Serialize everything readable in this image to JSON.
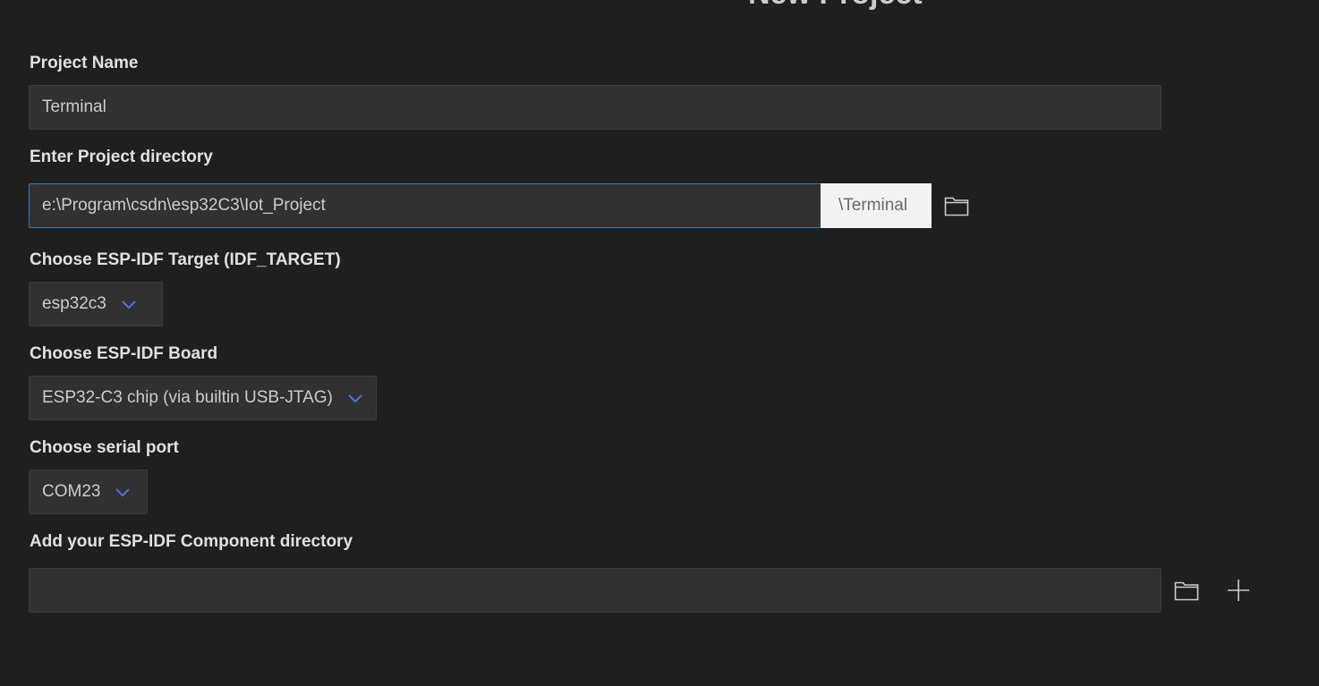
{
  "page_title": "New Project",
  "project_name": {
    "label": "Project Name",
    "value": "Terminal"
  },
  "project_directory": {
    "label": "Enter Project directory",
    "value": "e:\\Program\\csdn\\esp32C3\\Iot_Project",
    "suffix": "\\Terminal",
    "browse_icon": "folder-icon"
  },
  "idf_target": {
    "label": "Choose ESP-IDF Target (IDF_TARGET)",
    "selected": "esp32c3",
    "icon": "chevron-down-icon"
  },
  "idf_board": {
    "label": "Choose ESP-IDF Board",
    "selected": "ESP32-C3 chip (via builtin USB-JTAG)",
    "icon": "chevron-down-icon"
  },
  "serial_port": {
    "label": "Choose serial port",
    "selected": "COM23",
    "icon": "chevron-down-icon"
  },
  "component_directory": {
    "label": "Add your ESP-IDF Component directory",
    "value": "",
    "browse_icon": "folder-icon",
    "add_icon": "plus-icon"
  },
  "colors": {
    "background": "#1f1f1f",
    "input_background": "#313131",
    "focus_border": "#2f7cc7",
    "chevron": "#5b6fd6",
    "suffix_background": "#f3f3f3"
  }
}
